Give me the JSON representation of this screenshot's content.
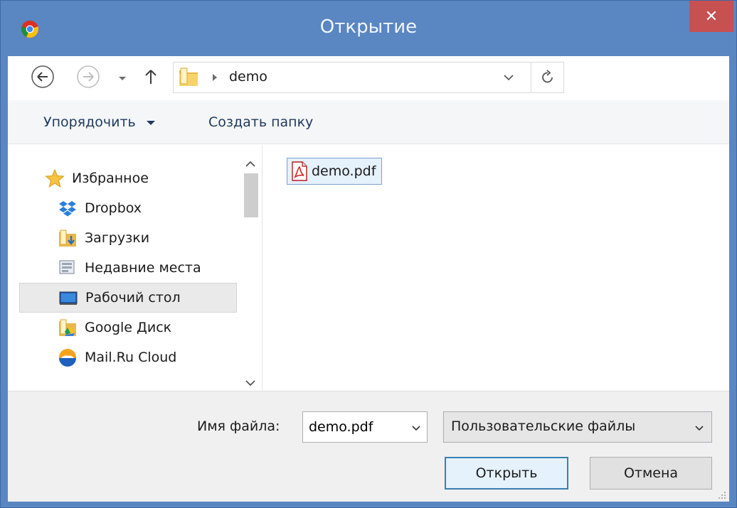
{
  "window": {
    "title": "Открытие",
    "close_symbol": "✕",
    "app_icon": "chrome-icon",
    "colors": {
      "frame": "#5a86c2",
      "close": "#c75050",
      "selection": "#e5f1fb",
      "selection_border": "#7da2ce"
    }
  },
  "navigation": {
    "back_icon": "back-arrow-icon",
    "forward_icon": "forward-arrow-icon",
    "recent_icon": "chevron-down-icon",
    "up_icon": "up-arrow-icon",
    "breadcrumb": [
      "demo"
    ],
    "refresh_icon": "refresh-icon"
  },
  "toolbar": {
    "organize_label": "Упорядочить",
    "new_folder_label": "Создать папку"
  },
  "sidebar": {
    "favorites_label": "Избранное",
    "items": [
      {
        "label": "Dropbox",
        "icon": "dropbox-icon"
      },
      {
        "label": "Загрузки",
        "icon": "downloads-folder-icon"
      },
      {
        "label": "Недавние места",
        "icon": "recent-places-icon"
      },
      {
        "label": "Рабочий стол",
        "icon": "desktop-icon",
        "selected": true
      },
      {
        "label": "Google Диск",
        "icon": "google-drive-icon"
      },
      {
        "label": "Mail.Ru Cloud",
        "icon": "mailru-cloud-icon"
      }
    ]
  },
  "files": [
    {
      "name": "demo.pdf",
      "icon": "pdf-icon",
      "selected": true
    }
  ],
  "footer": {
    "filename_label": "Имя файла:",
    "filename_value": "demo.pdf",
    "filetype_value": "Пользовательские файлы",
    "open_label": "Открыть",
    "cancel_label": "Отмена"
  }
}
